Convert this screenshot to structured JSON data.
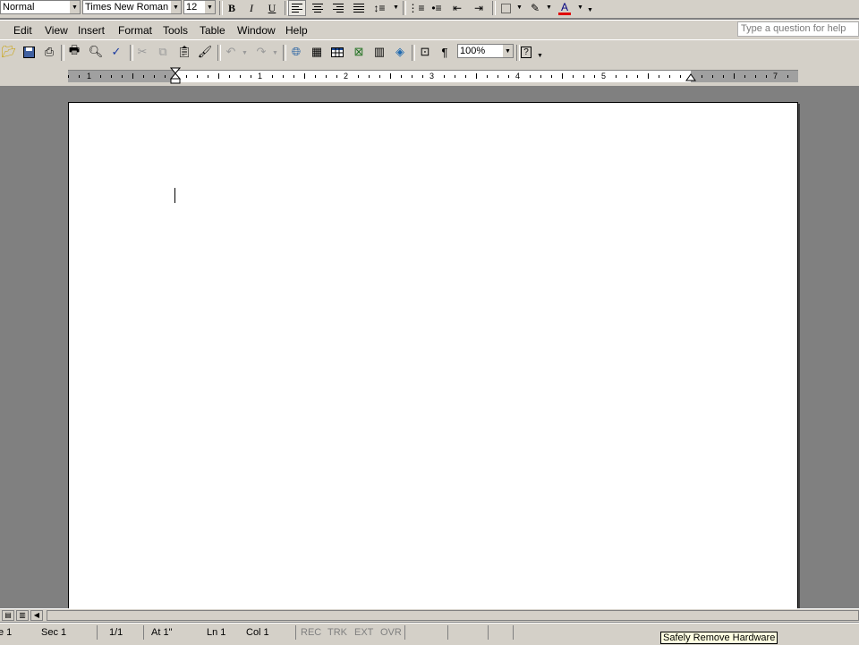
{
  "formatting_toolbar": {
    "style": "Normal",
    "font": "Times New Roman",
    "font_size": "12",
    "bold": "B",
    "italic": "I",
    "underline": "U",
    "active_alignment": "align-left",
    "font_color": "#e00000",
    "highlight_color": "#ffff00"
  },
  "menu": {
    "items": [
      "Edit",
      "View",
      "Insert",
      "Format",
      "Tools",
      "Table",
      "Window",
      "Help"
    ]
  },
  "help_box": {
    "placeholder": "Type a question for help"
  },
  "standard_toolbar": {
    "zoom": "100%"
  },
  "ruler": {
    "numbers": [
      "1",
      "1",
      "2",
      "3",
      "4",
      "5",
      "7"
    ]
  },
  "status_bar": {
    "page": "e 1",
    "section": "Sec 1",
    "page_of": "1/1",
    "at": "At 1\"",
    "line": "Ln 1",
    "column": "Col 1",
    "rec": "REC",
    "trk": "TRK",
    "ext": "EXT",
    "ovr": "OVR"
  },
  "tooltip": "Safely Remove Hardware"
}
